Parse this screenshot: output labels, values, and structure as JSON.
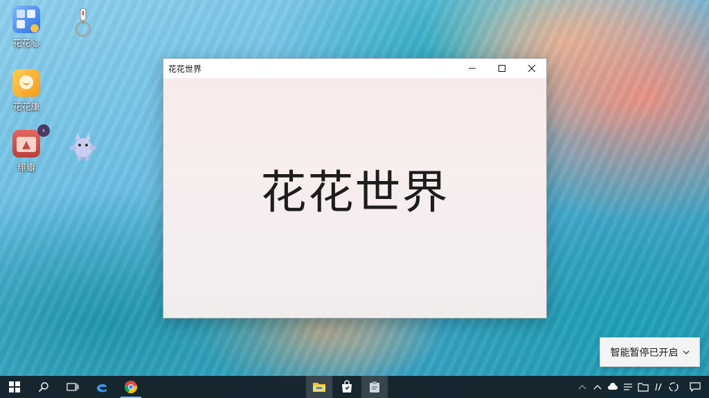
{
  "desktop": {
    "icons": [
      {
        "label": "花花心"
      },
      {
        "label": "花花康"
      },
      {
        "label": "绯瓣"
      }
    ]
  },
  "window": {
    "title": "花花世界",
    "content_text": "花花世界"
  },
  "toast": {
    "text": "智能暂停已开启"
  },
  "colors": {
    "taskbar": "#141c24",
    "window_bg": "#f7eded",
    "accent": "#0078d7"
  }
}
